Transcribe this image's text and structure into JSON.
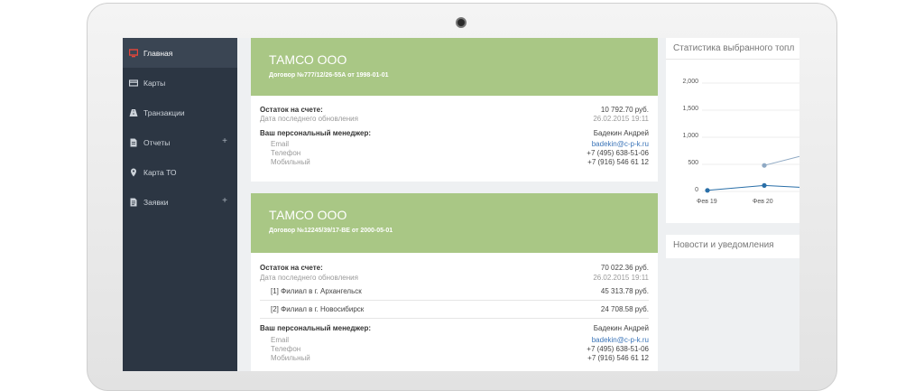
{
  "sidebar": {
    "items": [
      {
        "label": "Главная",
        "icon": "monitor-icon",
        "active": true,
        "expandable": false
      },
      {
        "label": "Карты",
        "icon": "card-icon",
        "active": false,
        "expandable": false
      },
      {
        "label": "Транзакции",
        "icon": "road-icon",
        "active": false,
        "expandable": false
      },
      {
        "label": "Отчеты",
        "icon": "document-icon",
        "active": false,
        "expandable": true
      },
      {
        "label": "Карта ТО",
        "icon": "map-pin-icon",
        "active": false,
        "expandable": false
      },
      {
        "label": "Заявки",
        "icon": "file-icon",
        "active": false,
        "expandable": true
      }
    ],
    "plus": "+"
  },
  "cards": [
    {
      "company": "ТАМСО ООО",
      "contract": "Договор №777/12/26-55А от 1998-01-01",
      "balance_label": "Остаток на счете:",
      "balance_value": "10 792.70 руб.",
      "updated_label": "Дата последнего обновления",
      "updated_value": "26.02.2015 19:11",
      "manager_label": "Ваш персональный менеджер:",
      "manager_name": "Бадекин Андрей",
      "email_label": "Email",
      "email_value": "badekin@c-p-k.ru",
      "phone_label": "Телефон",
      "phone_value": "+7 (495) 638-51-06",
      "mobile_label": "Мобильный",
      "mobile_value": "+7 (916) 546 61 12"
    },
    {
      "company": "ТАМСО ООО",
      "contract": "Договор №12245/39/17-ВЕ от 2000-05-01",
      "balance_label": "Остаток на счете:",
      "balance_value": "70 022.36 руб.",
      "updated_label": "Дата последнего обновления",
      "updated_value": "26.02.2015 19:11",
      "branches": [
        {
          "label": "[1] Филиал в г. Архангельск",
          "value": "45 313.78 руб."
        },
        {
          "label": "[2] Филиал в г. Новосибирск",
          "value": "24 708.58 руб."
        }
      ],
      "manager_label": "Ваш персональный менеджер:",
      "manager_name": "Бадекин Андрей",
      "email_label": "Email",
      "email_value": "badekin@c-p-k.ru",
      "phone_label": "Телефон",
      "phone_value": "+7 (495) 638-51-06",
      "mobile_label": "Мобильный",
      "mobile_value": "+7 (916) 546 61 12"
    }
  ],
  "right": {
    "stats_title": "Статистика выбранного топл",
    "news_title": "Новости и уведомления"
  },
  "chart_data": {
    "type": "line",
    "categories": [
      "Фев 19",
      "Фев 20"
    ],
    "yticks": [
      "2,000",
      "1,500",
      "1,000",
      "500",
      "0"
    ],
    "ylim": [
      0,
      2000
    ],
    "series": [
      {
        "color": "#2a6fa8",
        "values": [
          20,
          110
        ]
      },
      {
        "color": "#8fa9c4",
        "values": [
          null,
          480
        ]
      }
    ],
    "grid": true
  },
  "colors": {
    "sidebar_bg": "#2c3643",
    "card_header": "#a9c785",
    "link": "#3a74b8",
    "active_icon": "#e8463a"
  }
}
